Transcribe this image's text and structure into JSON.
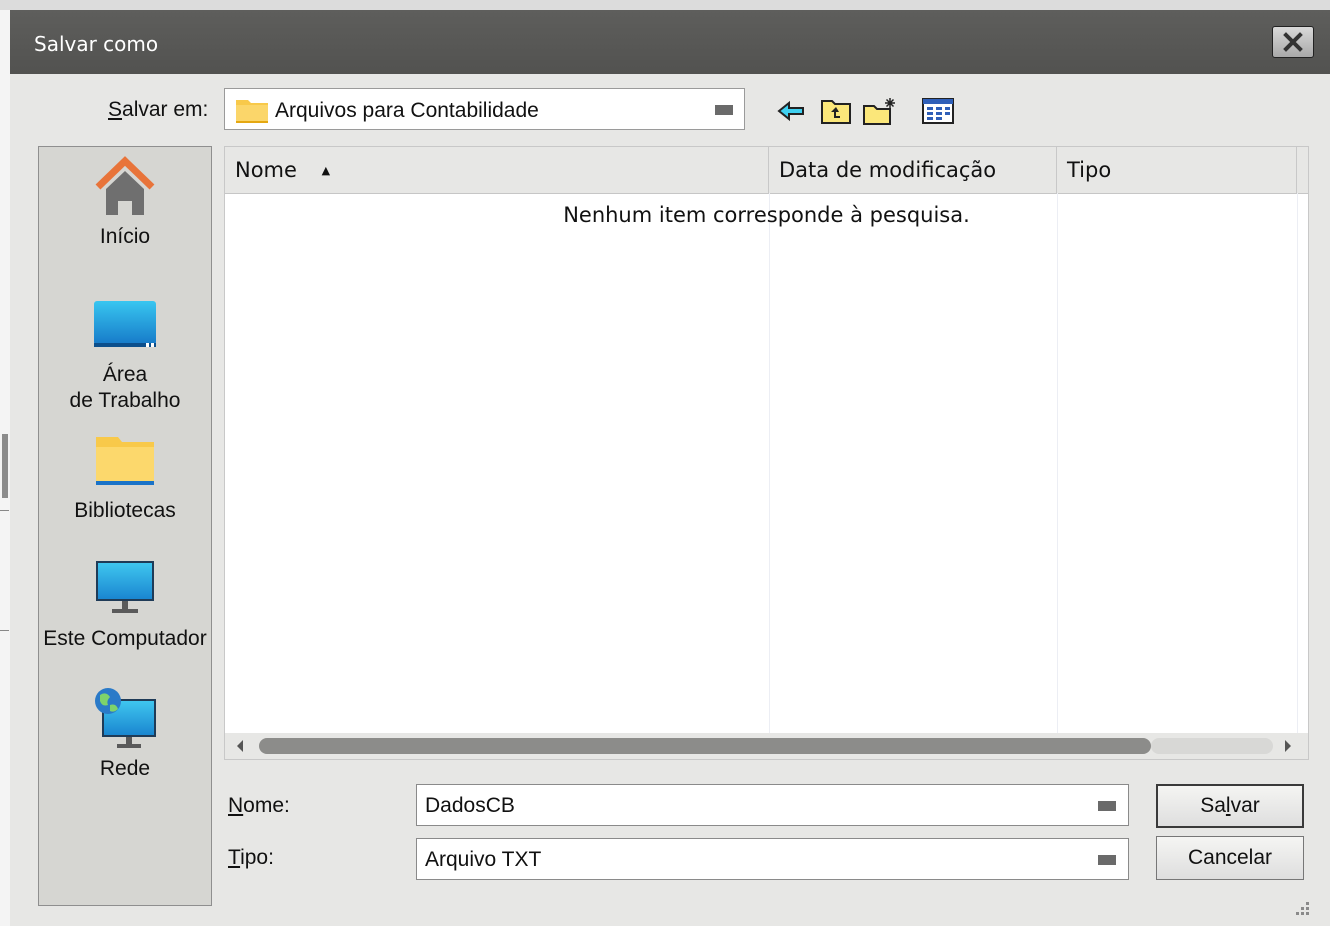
{
  "dialog": {
    "title": "Salvar como",
    "close_icon": "close-icon"
  },
  "location": {
    "label_accel": "S",
    "label_rest": "alvar em:",
    "value": "Arquivos para Contabilidade",
    "folder_icon": "folder-icon"
  },
  "toolbar": {
    "icons": [
      "back-arrow-icon",
      "up-folder-icon",
      "new-folder-icon",
      "view-menu-icon"
    ]
  },
  "places": [
    {
      "label": "Início",
      "icon": "home-icon"
    },
    {
      "label": "Área\nde Trabalho",
      "icon": "desktop-icon"
    },
    {
      "label": "Bibliotecas",
      "icon": "libraries-icon"
    },
    {
      "label": "Este Computador",
      "icon": "computer-icon"
    },
    {
      "label": "Rede",
      "icon": "network-icon"
    }
  ],
  "file_list": {
    "columns": [
      "Nome",
      "Data de modificação",
      "Tipo"
    ],
    "sort_indicator": "▲",
    "empty_message": "Nenhum item corresponde à pesquisa."
  },
  "form": {
    "name_label_accel": "N",
    "name_label_rest": "ome:",
    "name_value": "DadosCB",
    "type_label_accel": "T",
    "type_label_rest": "ipo:",
    "type_value": "Arquivo TXT"
  },
  "buttons": {
    "save_pre": "Sa",
    "save_accel": "l",
    "save_post": "var",
    "cancel": "Cancelar"
  },
  "colors": {
    "titlebar": "#525250",
    "dialog_bg": "#e7e7e5",
    "folder_yellow": "#f8c94a",
    "home_orange": "#e8743a"
  }
}
